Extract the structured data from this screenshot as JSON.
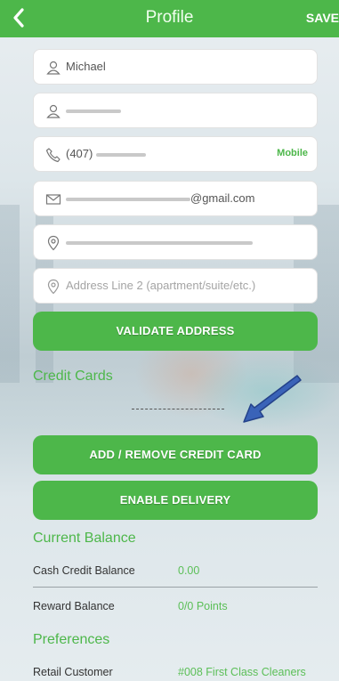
{
  "header": {
    "title": "Profile",
    "save_label": "SAVE",
    "back_icon": "chevron-left-icon",
    "color": "#4db74a"
  },
  "form": {
    "first_name": "Michael",
    "phone_prefix": "(407)",
    "phone_type": "Mobile",
    "email_suffix": "@gmail.com",
    "address2_placeholder": "Address Line 2 (apartment/suite/etc.)"
  },
  "buttons": {
    "validate_address": "VALIDATE ADDRESS",
    "add_remove_card": "ADD / REMOVE CREDIT CARD",
    "enable_delivery": "ENABLE DELIVERY"
  },
  "credit_cards": {
    "heading": "Credit Cards"
  },
  "balance": {
    "heading": "Current Balance",
    "rows": [
      {
        "label": "Cash Credit Balance",
        "value": "0.00"
      },
      {
        "label": "Reward Balance",
        "value": "0/0 Points"
      }
    ]
  },
  "preferences": {
    "heading": "Preferences",
    "rows": [
      {
        "label": "Retail Customer",
        "value": "#008 First Class Cleaners"
      }
    ]
  }
}
